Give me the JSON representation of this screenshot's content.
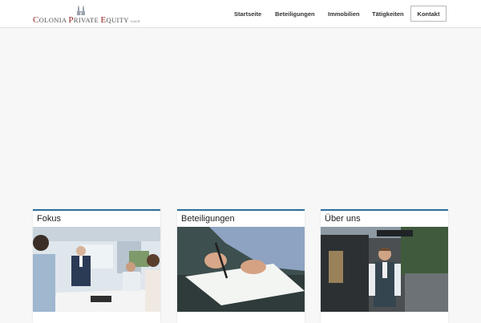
{
  "brand": {
    "logo_c": "C",
    "logo_olonia": "OLONIA",
    "logo_p": "P",
    "logo_rivate": "RIVATE",
    "logo_e": "E",
    "logo_quity": "QUITY",
    "logo_gmbh": "GmbH"
  },
  "nav": {
    "items": [
      "Startseite",
      "Beteiligungen",
      "Immobilien",
      "Tätigkeiten"
    ],
    "contact": "Kontakt"
  },
  "cards": [
    {
      "title": "Fokus",
      "image": "business-meeting-photo"
    },
    {
      "title": "Beteiligungen",
      "image": "signing-contract-photo"
    },
    {
      "title": "Über uns",
      "image": "businessman-street-photo"
    }
  ],
  "colors": {
    "accent": "#2c6f9c",
    "logo_red": "#8f1f1b",
    "background": "#f7f7f7"
  }
}
